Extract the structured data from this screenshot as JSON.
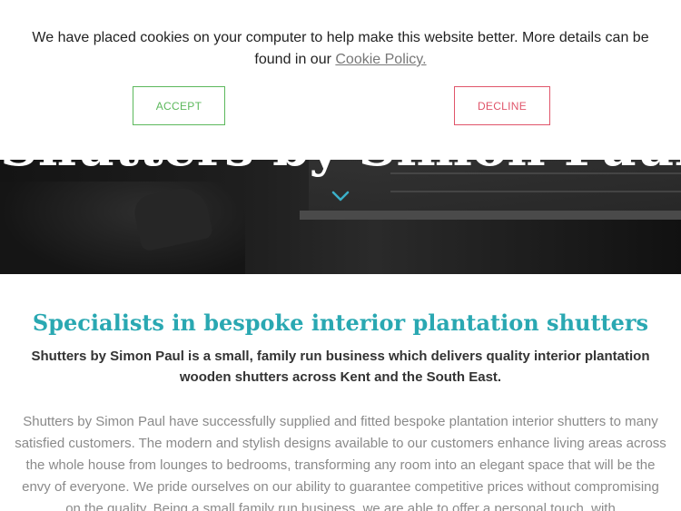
{
  "cookie_banner": {
    "message": "We have placed cookies on your computer to help make this website better. More details can be found in our",
    "link_label": "Cookie Policy.",
    "accept_label": "ACCEPT",
    "decline_label": "DECLINE"
  },
  "hero": {
    "title": "Shutters by Simon Paul",
    "scroll_icon": "chevron-down-icon"
  },
  "intro": {
    "heading": "Specialists in bespoke interior plantation shutters",
    "lead": "Shutters by Simon Paul is a small, family run business which delivers quality interior plantation wooden shutters across Kent and the South East.",
    "body": "Shutters by Simon Paul have successfully supplied and fitted bespoke plantation interior shutters to many satisfied customers. The modern and stylish designs available to our customers enhance living areas across the whole house from lounges to bedrooms, transforming any room into an elegant space that will be the envy of everyone. We pride ourselves on our ability to guarantee competitive prices without compromising on the quality. Being a small family run business, we are able to offer a personal touch, with"
  },
  "colors": {
    "heading": "#2aa8b2",
    "accept": "#5cb85c",
    "decline": "#e0556a",
    "chevron": "#3bb0c9"
  }
}
